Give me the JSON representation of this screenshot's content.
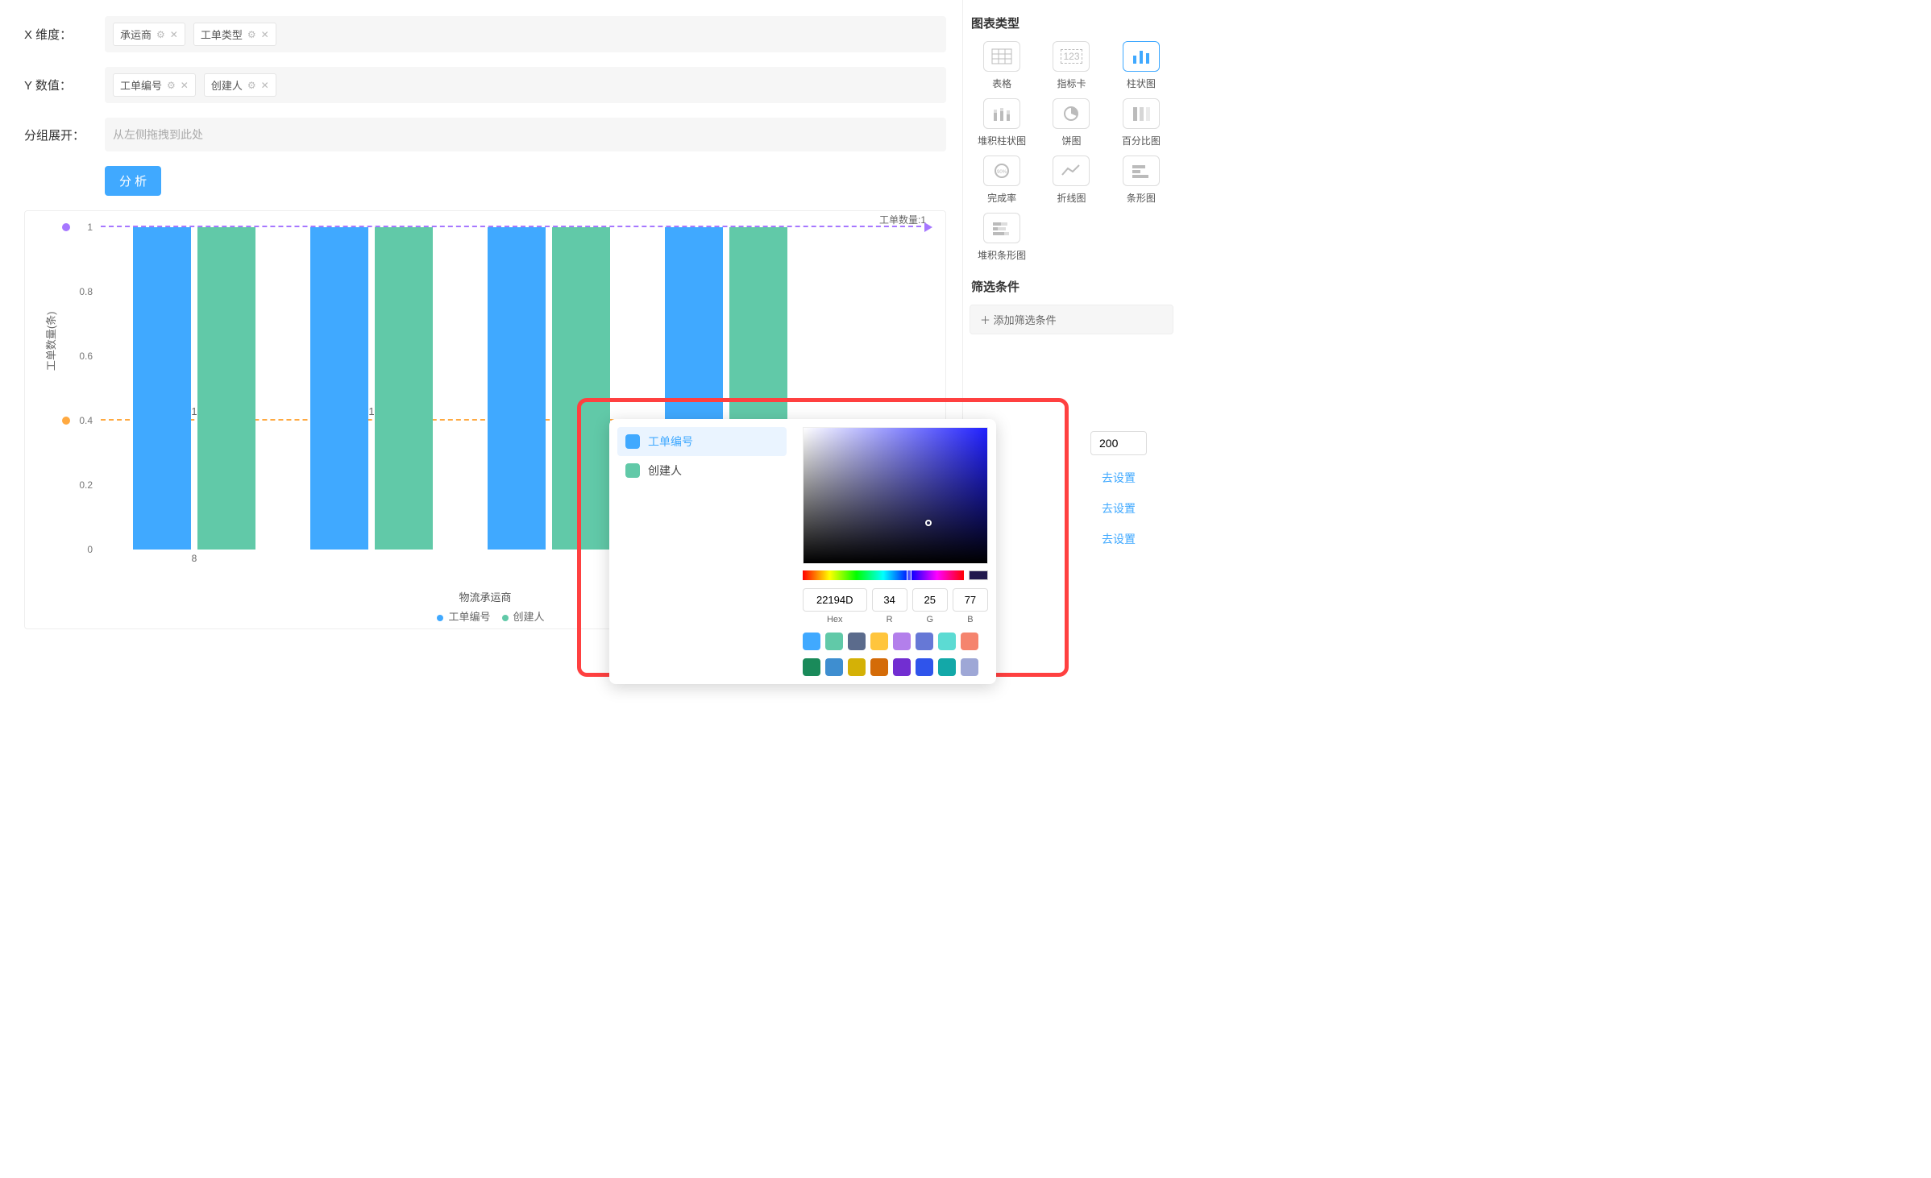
{
  "config": {
    "x_label": "X 维度：",
    "y_label": "Y 数值：",
    "group_label": "分组展开：",
    "group_placeholder": "从左侧拖拽到此处",
    "x_tags": [
      "承运商",
      "工单类型"
    ],
    "y_tags": [
      "工单编号",
      "创建人"
    ],
    "analyze": "分 析"
  },
  "chart_data": {
    "type": "bar",
    "y_axis_label": "工单数量(条)",
    "x_axis_label": "物流承运商",
    "categories": [
      "8",
      "",
      "",
      ""
    ],
    "series": [
      {
        "name": "工单编号",
        "color": "#40a9ff",
        "values": [
          1,
          1,
          1,
          1
        ]
      },
      {
        "name": "创建人",
        "color": "#61c9a8",
        "values": [
          1,
          1,
          1,
          1
        ]
      }
    ],
    "y_ticks": [
      0,
      0.2,
      0.4,
      0.6,
      0.8,
      1
    ],
    "ylim": [
      0,
      1
    ],
    "reference_lines": [
      {
        "value": 1,
        "label": "工单数量:1",
        "dot_color": "#a677ff",
        "line_color": "purple",
        "arrow": true
      },
      {
        "value": 0.4,
        "label": "",
        "dot_color": "#ffa940",
        "line_color": "orange",
        "arrow": false
      }
    ],
    "bar_labels": [
      "1",
      "1",
      "",
      ""
    ]
  },
  "side": {
    "chart_types_title": "图表类型",
    "chart_types": [
      {
        "key": "table",
        "label": "表格"
      },
      {
        "key": "indicator",
        "label": "指标卡"
      },
      {
        "key": "bar",
        "label": "柱状图",
        "selected": true
      },
      {
        "key": "stackbar",
        "label": "堆积柱状图"
      },
      {
        "key": "pie",
        "label": "饼图"
      },
      {
        "key": "percent",
        "label": "百分比图"
      },
      {
        "key": "gauge",
        "label": "完成率"
      },
      {
        "key": "line",
        "label": "折线图"
      },
      {
        "key": "hbar",
        "label": "条形图"
      },
      {
        "key": "stackhbar",
        "label": "堆积条形图"
      }
    ],
    "filter_title": "筛选条件",
    "add_filter": "＋ 添加筛选条件",
    "num_value": "200",
    "go_setting": "去设置"
  },
  "color_popup": {
    "items": [
      {
        "label": "工单编号",
        "color": "#40a9ff",
        "active": true
      },
      {
        "label": "创建人",
        "color": "#61c9a8",
        "active": false
      }
    ],
    "hex": "22194D",
    "r": "34",
    "g": "25",
    "b": "77",
    "hex_label": "Hex",
    "r_label": "R",
    "g_label": "G",
    "b_label": "B",
    "current_color": "#22194D",
    "sv_cursor": {
      "left_pct": 68,
      "top_pct": 70
    },
    "hue_cursor_pct": 66,
    "swatches_row1": [
      "#40a9ff",
      "#61c9a8",
      "#5b6b8c",
      "#ffc53d",
      "#b37feb",
      "#6678d6",
      "#5cdbd3",
      "#f5846e"
    ],
    "swatches_row2": [
      "#1a8a5a",
      "#3e8ed0",
      "#d4b106",
      "#d46b08",
      "#722ed1",
      "#2f54eb",
      "#13a8a8",
      "#9ea7d6"
    ]
  }
}
